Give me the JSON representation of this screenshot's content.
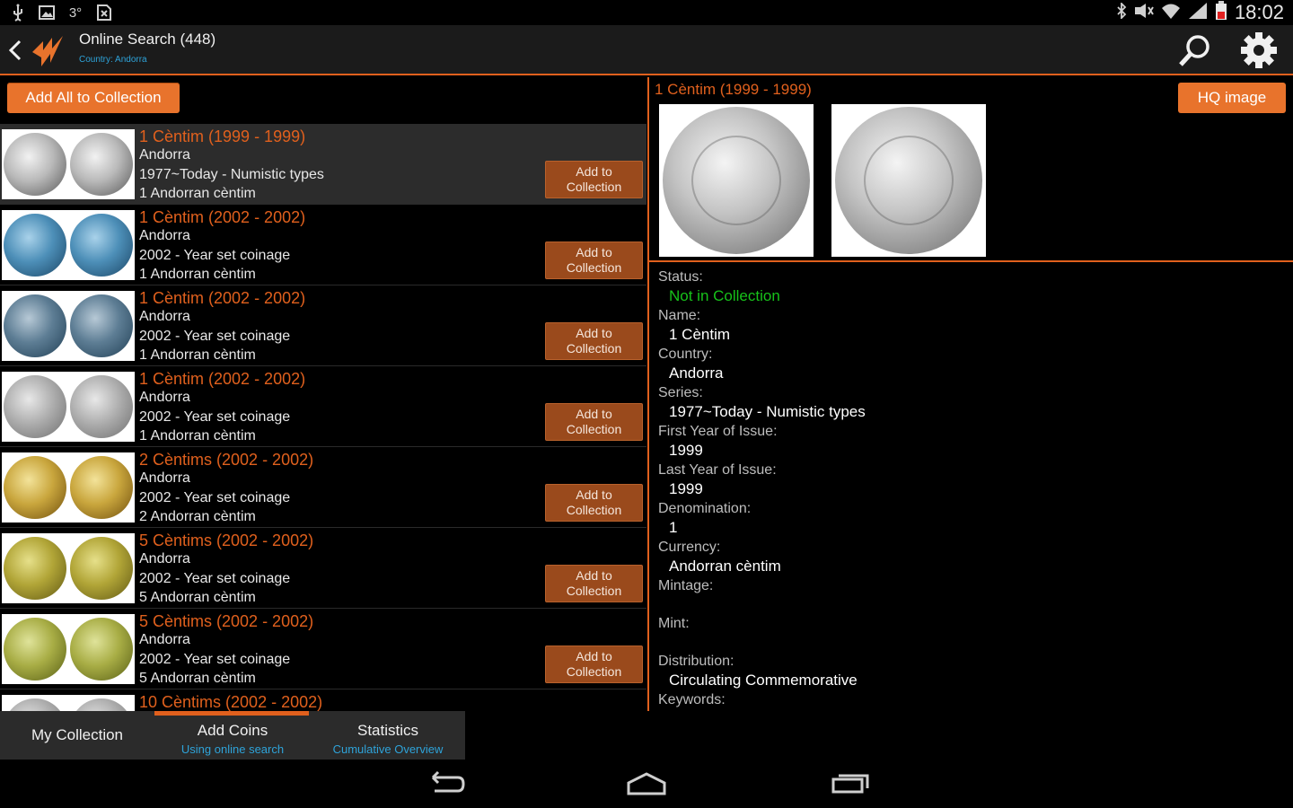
{
  "status_bar": {
    "time": "18:02",
    "left_icons": [
      "usb-icon",
      "image-icon",
      "temperature-icon",
      "sim-off-icon"
    ],
    "right_icons": [
      "bluetooth-icon",
      "mute-icon",
      "wifi-icon",
      "signal-icon",
      "battery-low-icon"
    ]
  },
  "action_bar": {
    "title": "Online Search (448)",
    "subtitle": "Country: Andorra"
  },
  "left_pane": {
    "add_all_label": "Add All to Collection",
    "row_button_label_line1": "Add to",
    "row_button_label_line2": "Collection",
    "items": [
      {
        "title": "1 Cèntim (1999 - 1999)",
        "country": "Andorra",
        "series": "1977~Today - Numistic types",
        "denomination": "1 Andorran cèntim",
        "coin_class": "c-silver",
        "selected": true
      },
      {
        "title": "1 Cèntim (2002 - 2002)",
        "country": "Andorra",
        "series": "2002 - Year set coinage",
        "denomination": "1 Andorran cèntim",
        "coin_class": "c-blue",
        "selected": false
      },
      {
        "title": "1 Cèntim (2002 - 2002)",
        "country": "Andorra",
        "series": "2002 - Year set coinage",
        "denomination": "1 Andorran cèntim",
        "coin_class": "c-steel",
        "selected": false
      },
      {
        "title": "1 Cèntim (2002 - 2002)",
        "country": "Andorra",
        "series": "2002 - Year set coinage",
        "denomination": "1 Andorran cèntim",
        "coin_class": "c-gray",
        "selected": false
      },
      {
        "title": "2 Cèntims (2002 - 2002)",
        "country": "Andorra",
        "series": "2002 - Year set coinage",
        "denomination": "2 Andorran cèntim",
        "coin_class": "c-gold",
        "selected": false
      },
      {
        "title": "5 Cèntims (2002 - 2002)",
        "country": "Andorra",
        "series": "2002 - Year set coinage",
        "denomination": "5 Andorran cèntim",
        "coin_class": "c-brass",
        "selected": false
      },
      {
        "title": "5 Cèntims (2002 - 2002)",
        "country": "Andorra",
        "series": "2002 - Year set coinage",
        "denomination": "5 Andorran cèntim",
        "coin_class": "c-olive",
        "selected": false
      },
      {
        "title": "10 Cèntims (2002 - 2002)",
        "country": "",
        "series": "",
        "denomination": "",
        "coin_class": "c-gray",
        "selected": false
      }
    ]
  },
  "detail": {
    "title": "1 Cèntim (1999 - 1999)",
    "hq_button_label": "HQ image",
    "fields": [
      {
        "label": "Status:",
        "value": "Not in Collection",
        "style": "green"
      },
      {
        "label": "Name:",
        "value": "1 Cèntim",
        "style": ""
      },
      {
        "label": "Country:",
        "value": "Andorra",
        "style": ""
      },
      {
        "label": "Series:",
        "value": "1977~Today - Numistic types",
        "style": ""
      },
      {
        "label": "First Year of Issue:",
        "value": "1999",
        "style": ""
      },
      {
        "label": "Last Year of Issue:",
        "value": "1999",
        "style": ""
      },
      {
        "label": "Denomination:",
        "value": "1",
        "style": ""
      },
      {
        "label": "Currency:",
        "value": "Andorran cèntim",
        "style": ""
      },
      {
        "label": "Mintage:",
        "value": "",
        "style": ""
      },
      {
        "label": "Mint:",
        "value": "",
        "style": ""
      },
      {
        "label": "Distribution:",
        "value": "Circulating Commemorative",
        "style": ""
      },
      {
        "label": "Keywords:",
        "value": "",
        "style": ""
      }
    ]
  },
  "bottom_tabs": {
    "my_collection": "My Collection",
    "add_coins": "Add Coins",
    "add_coins_sub": "Using online search",
    "statistics": "Statistics",
    "statistics_sub": "Cumulative Overview"
  },
  "colors": {
    "accent": "#e0601d",
    "button": "#e8732c",
    "link": "#2ea3d9",
    "in_collection_status": "#17c21a"
  }
}
